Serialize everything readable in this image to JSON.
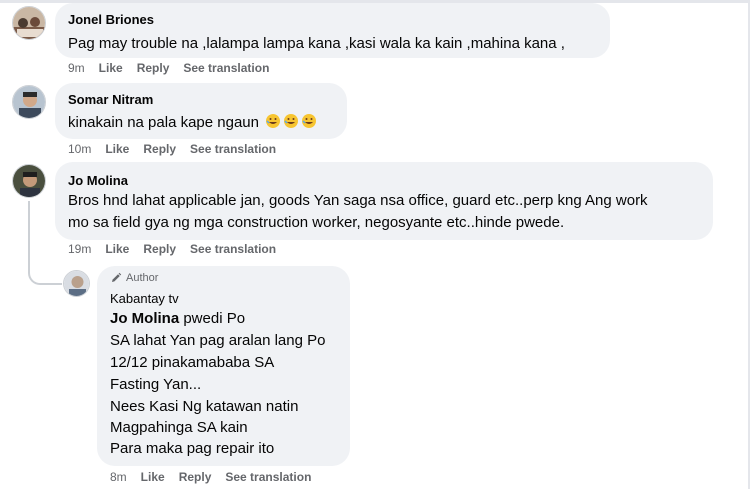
{
  "comments": [
    {
      "author": "Jonel Briones",
      "text": "Pag may trouble na ,lalampa lampa kana ,kasi wala ka kain ,mahina kana ,",
      "time": "9m",
      "like": "Like",
      "reply": "Reply",
      "translate": "See translation"
    },
    {
      "author": "Somar Nitram",
      "text": "kinakain na pala kape ngaun",
      "emojis": [
        "rolling-on-floor-laughing",
        "rolling-on-floor-laughing",
        "rolling-on-floor-laughing"
      ],
      "time": "10m",
      "like": "Like",
      "reply": "Reply",
      "translate": "See translation"
    },
    {
      "author": "Jo Molina",
      "text_lines": [
        "Bros hnd lahat applicable jan, goods Yan saga nsa office, guard etc..perp kng Ang work",
        "mo sa field gya ng mga construction worker, negosyante etc..hinde pwede."
      ],
      "time": "19m",
      "like": "Like",
      "reply": "Reply",
      "translate": "See translation"
    }
  ],
  "reply": {
    "badge": "Author",
    "author": "Kabantay tv",
    "mention": "Jo Molina",
    "first_line_rest": " pwedi Po",
    "lines": [
      "SA lahat Yan pag aralan lang Po",
      "12/12 pinakamababa SA",
      "Fasting Yan...",
      "Nees Kasi Ng katawan natin",
      "Magpahinga SA kain",
      "Para maka pag repair ito"
    ],
    "time": "8m",
    "like": "Like",
    "reply": "Reply",
    "translate": "See translation"
  },
  "colors": {
    "bubble": "#f0f2f5",
    "secondary_text": "#65676b",
    "primary_text": "#050505"
  }
}
